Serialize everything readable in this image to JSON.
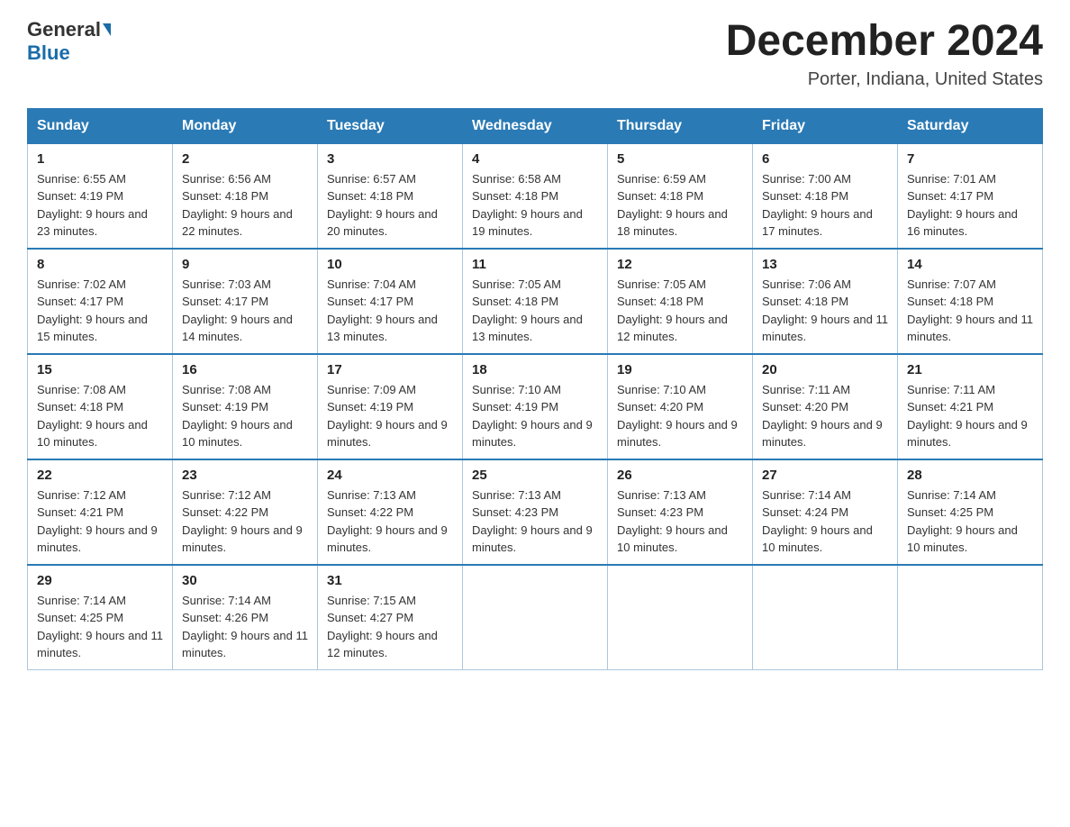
{
  "header": {
    "logo_line1": "General",
    "logo_line2": "Blue",
    "month_title": "December 2024",
    "location": "Porter, Indiana, United States"
  },
  "days_of_week": [
    "Sunday",
    "Monday",
    "Tuesday",
    "Wednesday",
    "Thursday",
    "Friday",
    "Saturday"
  ],
  "weeks": [
    [
      {
        "day": "1",
        "sunrise": "6:55 AM",
        "sunset": "4:19 PM",
        "daylight": "9 hours and 23 minutes."
      },
      {
        "day": "2",
        "sunrise": "6:56 AM",
        "sunset": "4:18 PM",
        "daylight": "9 hours and 22 minutes."
      },
      {
        "day": "3",
        "sunrise": "6:57 AM",
        "sunset": "4:18 PM",
        "daylight": "9 hours and 20 minutes."
      },
      {
        "day": "4",
        "sunrise": "6:58 AM",
        "sunset": "4:18 PM",
        "daylight": "9 hours and 19 minutes."
      },
      {
        "day": "5",
        "sunrise": "6:59 AM",
        "sunset": "4:18 PM",
        "daylight": "9 hours and 18 minutes."
      },
      {
        "day": "6",
        "sunrise": "7:00 AM",
        "sunset": "4:18 PM",
        "daylight": "9 hours and 17 minutes."
      },
      {
        "day": "7",
        "sunrise": "7:01 AM",
        "sunset": "4:17 PM",
        "daylight": "9 hours and 16 minutes."
      }
    ],
    [
      {
        "day": "8",
        "sunrise": "7:02 AM",
        "sunset": "4:17 PM",
        "daylight": "9 hours and 15 minutes."
      },
      {
        "day": "9",
        "sunrise": "7:03 AM",
        "sunset": "4:17 PM",
        "daylight": "9 hours and 14 minutes."
      },
      {
        "day": "10",
        "sunrise": "7:04 AM",
        "sunset": "4:17 PM",
        "daylight": "9 hours and 13 minutes."
      },
      {
        "day": "11",
        "sunrise": "7:05 AM",
        "sunset": "4:18 PM",
        "daylight": "9 hours and 13 minutes."
      },
      {
        "day": "12",
        "sunrise": "7:05 AM",
        "sunset": "4:18 PM",
        "daylight": "9 hours and 12 minutes."
      },
      {
        "day": "13",
        "sunrise": "7:06 AM",
        "sunset": "4:18 PM",
        "daylight": "9 hours and 11 minutes."
      },
      {
        "day": "14",
        "sunrise": "7:07 AM",
        "sunset": "4:18 PM",
        "daylight": "9 hours and 11 minutes."
      }
    ],
    [
      {
        "day": "15",
        "sunrise": "7:08 AM",
        "sunset": "4:18 PM",
        "daylight": "9 hours and 10 minutes."
      },
      {
        "day": "16",
        "sunrise": "7:08 AM",
        "sunset": "4:19 PM",
        "daylight": "9 hours and 10 minutes."
      },
      {
        "day": "17",
        "sunrise": "7:09 AM",
        "sunset": "4:19 PM",
        "daylight": "9 hours and 9 minutes."
      },
      {
        "day": "18",
        "sunrise": "7:10 AM",
        "sunset": "4:19 PM",
        "daylight": "9 hours and 9 minutes."
      },
      {
        "day": "19",
        "sunrise": "7:10 AM",
        "sunset": "4:20 PM",
        "daylight": "9 hours and 9 minutes."
      },
      {
        "day": "20",
        "sunrise": "7:11 AM",
        "sunset": "4:20 PM",
        "daylight": "9 hours and 9 minutes."
      },
      {
        "day": "21",
        "sunrise": "7:11 AM",
        "sunset": "4:21 PM",
        "daylight": "9 hours and 9 minutes."
      }
    ],
    [
      {
        "day": "22",
        "sunrise": "7:12 AM",
        "sunset": "4:21 PM",
        "daylight": "9 hours and 9 minutes."
      },
      {
        "day": "23",
        "sunrise": "7:12 AM",
        "sunset": "4:22 PM",
        "daylight": "9 hours and 9 minutes."
      },
      {
        "day": "24",
        "sunrise": "7:13 AM",
        "sunset": "4:22 PM",
        "daylight": "9 hours and 9 minutes."
      },
      {
        "day": "25",
        "sunrise": "7:13 AM",
        "sunset": "4:23 PM",
        "daylight": "9 hours and 9 minutes."
      },
      {
        "day": "26",
        "sunrise": "7:13 AM",
        "sunset": "4:23 PM",
        "daylight": "9 hours and 10 minutes."
      },
      {
        "day": "27",
        "sunrise": "7:14 AM",
        "sunset": "4:24 PM",
        "daylight": "9 hours and 10 minutes."
      },
      {
        "day": "28",
        "sunrise": "7:14 AM",
        "sunset": "4:25 PM",
        "daylight": "9 hours and 10 minutes."
      }
    ],
    [
      {
        "day": "29",
        "sunrise": "7:14 AM",
        "sunset": "4:25 PM",
        "daylight": "9 hours and 11 minutes."
      },
      {
        "day": "30",
        "sunrise": "7:14 AM",
        "sunset": "4:26 PM",
        "daylight": "9 hours and 11 minutes."
      },
      {
        "day": "31",
        "sunrise": "7:15 AM",
        "sunset": "4:27 PM",
        "daylight": "9 hours and 12 minutes."
      },
      null,
      null,
      null,
      null
    ]
  ]
}
